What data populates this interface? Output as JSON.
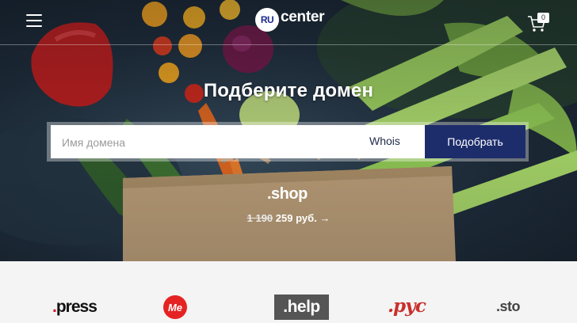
{
  "header": {
    "logo": {
      "badge": "RU",
      "text": "center"
    },
    "cart_count": "0"
  },
  "hero": {
    "title": "Подберите домен",
    "search": {
      "placeholder": "Имя домена",
      "value": "",
      "whois_label": "Whois",
      "submit_label": "Подобрать"
    },
    "promo": {
      "zone": ".shop",
      "old_price": "1 190",
      "new_price": "259 руб.",
      "arrow": "→"
    }
  },
  "zones_strip": {
    "items": [
      {
        "name": ".press",
        "text": "press"
      },
      {
        "name": "me",
        "text": "Me"
      },
      {
        "name": ".help",
        "text": ".help"
      },
      {
        "name": "рус",
        "text": ".рус"
      },
      {
        "name": ".store",
        "text": ".sto"
      }
    ]
  },
  "colors": {
    "brand": "#1d2d6b",
    "accent_red": "#e62323"
  },
  "icons": [
    "hamburger-menu-icon",
    "cart-icon",
    "arrow-right-icon"
  ]
}
